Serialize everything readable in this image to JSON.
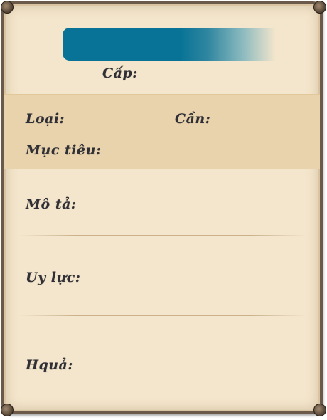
{
  "panel": {
    "level_label": "Cấp:",
    "type_label": "Loại:",
    "required_label": "Cần:",
    "target_label": "Mục tiêu:",
    "description_label": "Mô tả:",
    "power_label": "Uy lực:",
    "effect_label": "Hquả:"
  },
  "colors": {
    "banner": "#087396",
    "parchment": "#f4e6cc",
    "band": "#e8d3ad",
    "frame": "#6b5a4a",
    "text": "#2f2f35"
  }
}
